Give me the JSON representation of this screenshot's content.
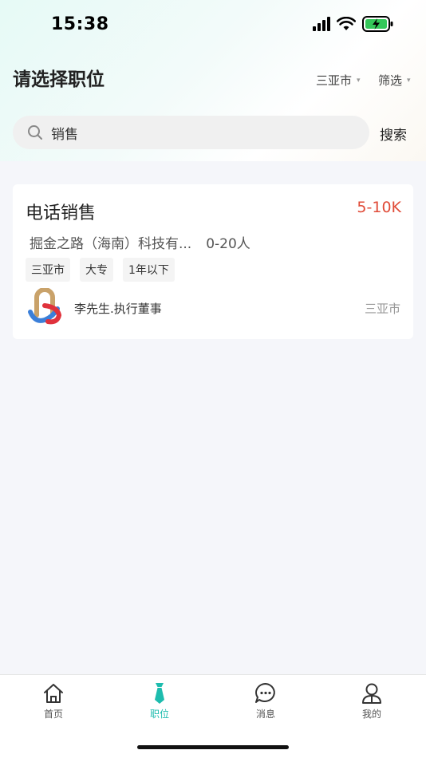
{
  "status_bar": {
    "time": "15:38"
  },
  "header": {
    "title": "请选择职位",
    "city_filter": "三亚市",
    "filter_label": "筛选"
  },
  "search": {
    "value": "销售",
    "button_label": "搜索"
  },
  "job": {
    "title": "电话销售",
    "salary": "5-10K",
    "company": "掘金之路（海南）科技有...",
    "company_size": "0-20人",
    "tags": [
      "三亚市",
      "大专",
      "1年以下"
    ],
    "recruiter": "李先生.执行董事",
    "city": "三亚市"
  },
  "tabbar": {
    "items": [
      {
        "label": "首页",
        "icon": "home-icon"
      },
      {
        "label": "职位",
        "icon": "tie-icon"
      },
      {
        "label": "消息",
        "icon": "chat-icon"
      },
      {
        "label": "我的",
        "icon": "user-icon"
      }
    ],
    "active_index": 1
  },
  "colors": {
    "accent": "#1dbcae",
    "salary": "#e04b38"
  }
}
